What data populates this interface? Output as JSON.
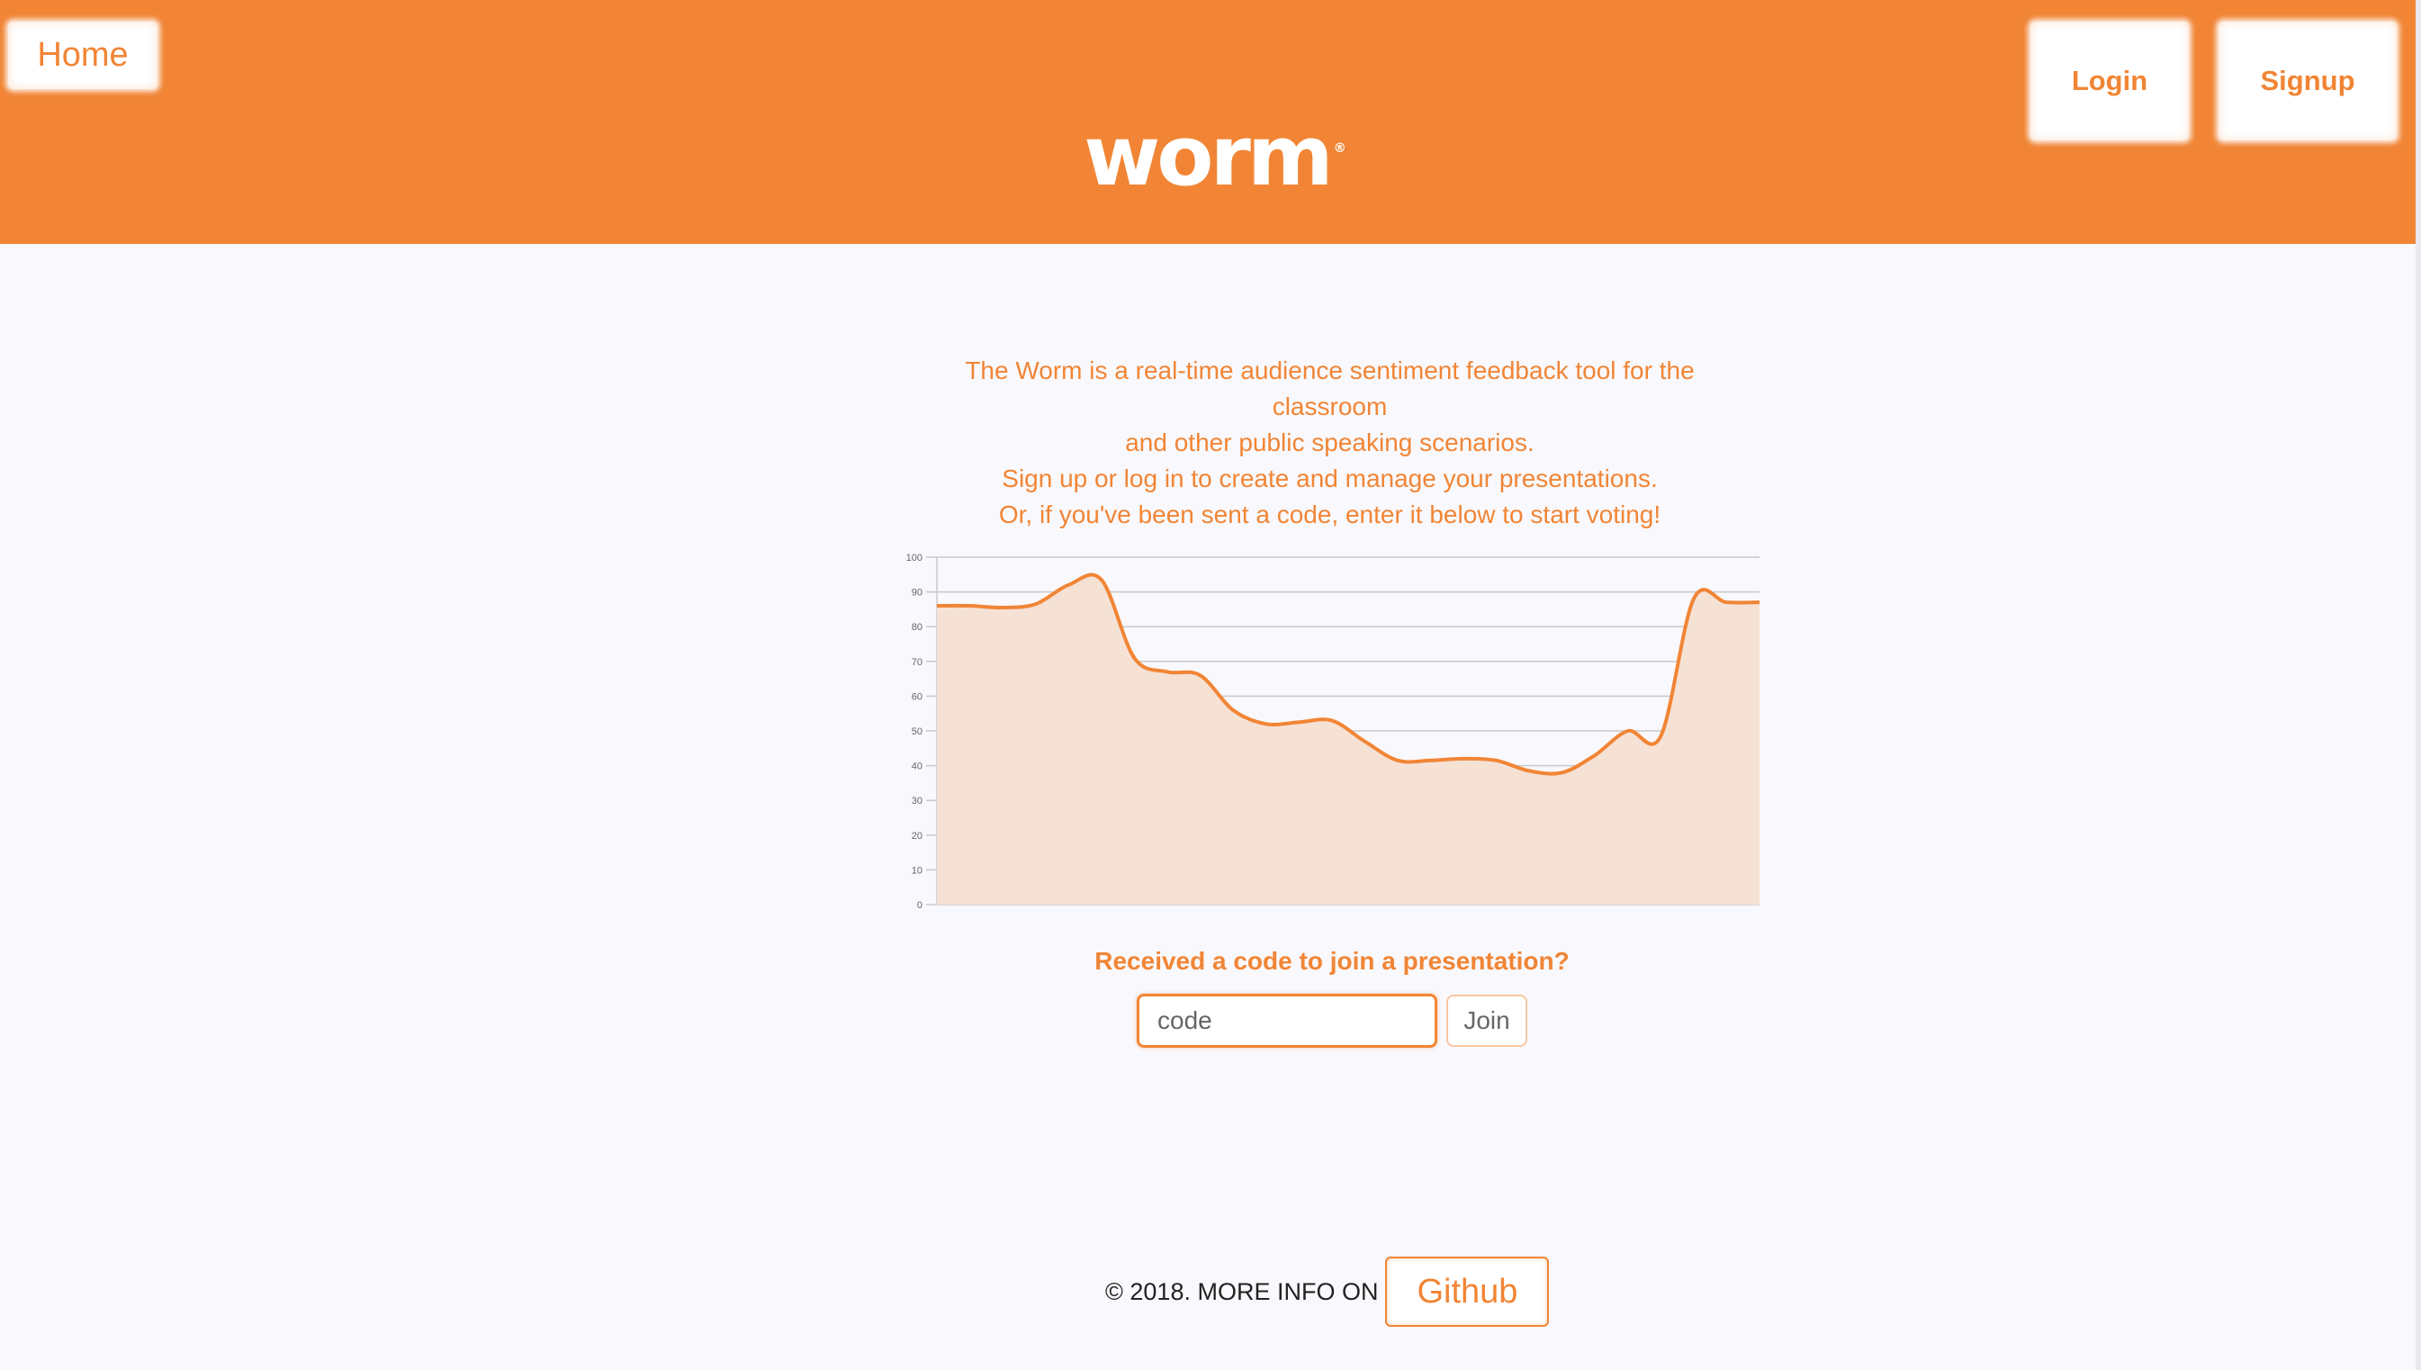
{
  "nav": {
    "home_label": "Home",
    "login_label": "Login",
    "signup_label": "Signup"
  },
  "logo": {
    "text": "worm",
    "mark": "®"
  },
  "intro": {
    "lines": [
      "The Worm is a real-time audience sentiment feedback tool for the",
      "classroom",
      "and other public speaking scenarios.",
      "Sign up or log in to create and manage your presentations.",
      "Or, if you've been sent a code, enter it below to start voting!"
    ]
  },
  "chart_data": {
    "type": "area",
    "title": "",
    "xlabel": "",
    "ylabel": "",
    "ylim": [
      0,
      100
    ],
    "yticks": [
      0,
      10,
      20,
      30,
      40,
      50,
      60,
      70,
      80,
      90,
      100
    ],
    "grid": true,
    "x": [
      0,
      2,
      4,
      6,
      8,
      10,
      12,
      14,
      16,
      18,
      20,
      22,
      24,
      26,
      28,
      30,
      32,
      34,
      36,
      38,
      40,
      42,
      44,
      46,
      48,
      50
    ],
    "series": [
      {
        "values": [
          86,
          86,
          85.5,
          86.5,
          92,
          93.5,
          71,
          67,
          66,
          56,
          52,
          52.5,
          53,
          47,
          41.5,
          41.5,
          42,
          41.5,
          38.5,
          38,
          43,
          50,
          48.5,
          88,
          87,
          87
        ],
        "color": "#f18535",
        "fill": "#f6e1d5"
      }
    ]
  },
  "join": {
    "title": "Received a code to join a presentation?",
    "placeholder": "code",
    "button_label": "Join"
  },
  "footer": {
    "text": "© 2018. MORE INFO ON",
    "github_label": "Github"
  },
  "colors": {
    "brand": "#f18535",
    "background": "#f9f8fc",
    "chart_fill": "#f6e1d5"
  }
}
